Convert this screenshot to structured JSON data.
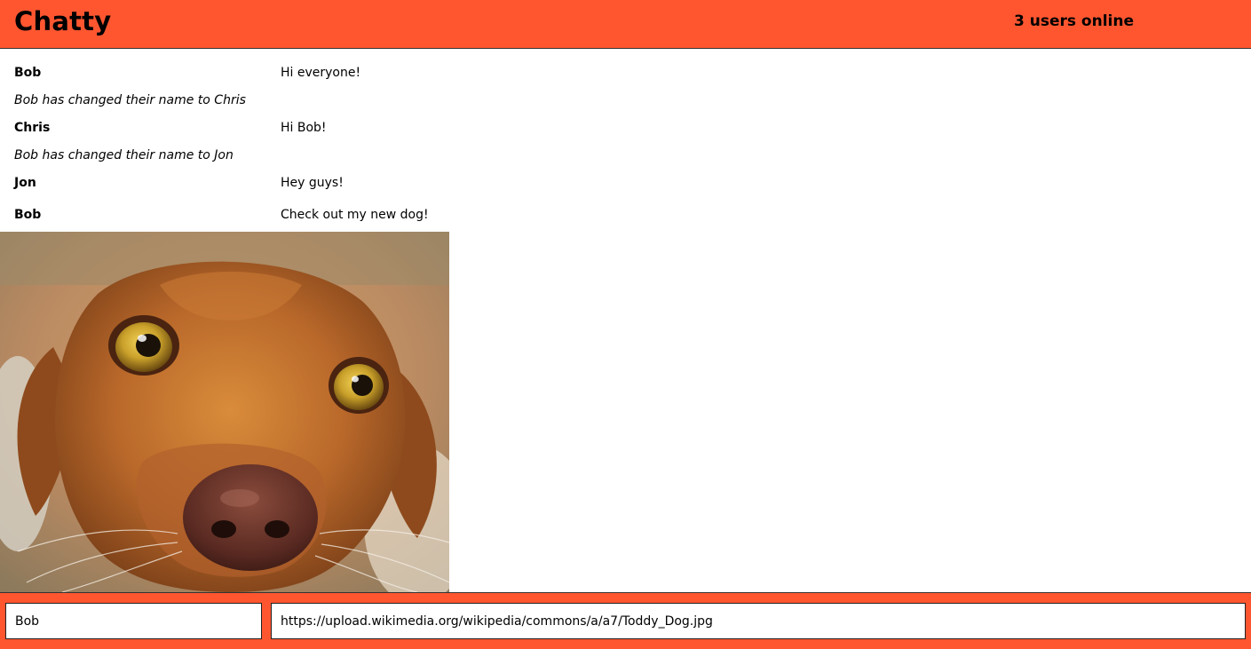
{
  "navbar": {
    "brand": "Chatty",
    "users_online": "3 users online"
  },
  "messages": [
    {
      "type": "message",
      "username": "Bob",
      "content": "Hi everyone!"
    },
    {
      "type": "notification",
      "text": "Bob has changed their name to Chris"
    },
    {
      "type": "message",
      "username": "Chris",
      "content": "Hi Bob!"
    },
    {
      "type": "notification",
      "text": "Bob has changed their name to Jon"
    },
    {
      "type": "message",
      "username": "Jon",
      "content": "Hey guys!"
    },
    {
      "type": "message",
      "username": "Bob",
      "content": "Check out my new dog!"
    }
  ],
  "image": {
    "icon": "dog-photo"
  },
  "chatbar": {
    "username_value": "Bob",
    "message_value": "https://upload.wikimedia.org/wikipedia/commons/a/a7/Toddy_Dog.jpg"
  },
  "colors": {
    "brand": "#ff5630"
  }
}
